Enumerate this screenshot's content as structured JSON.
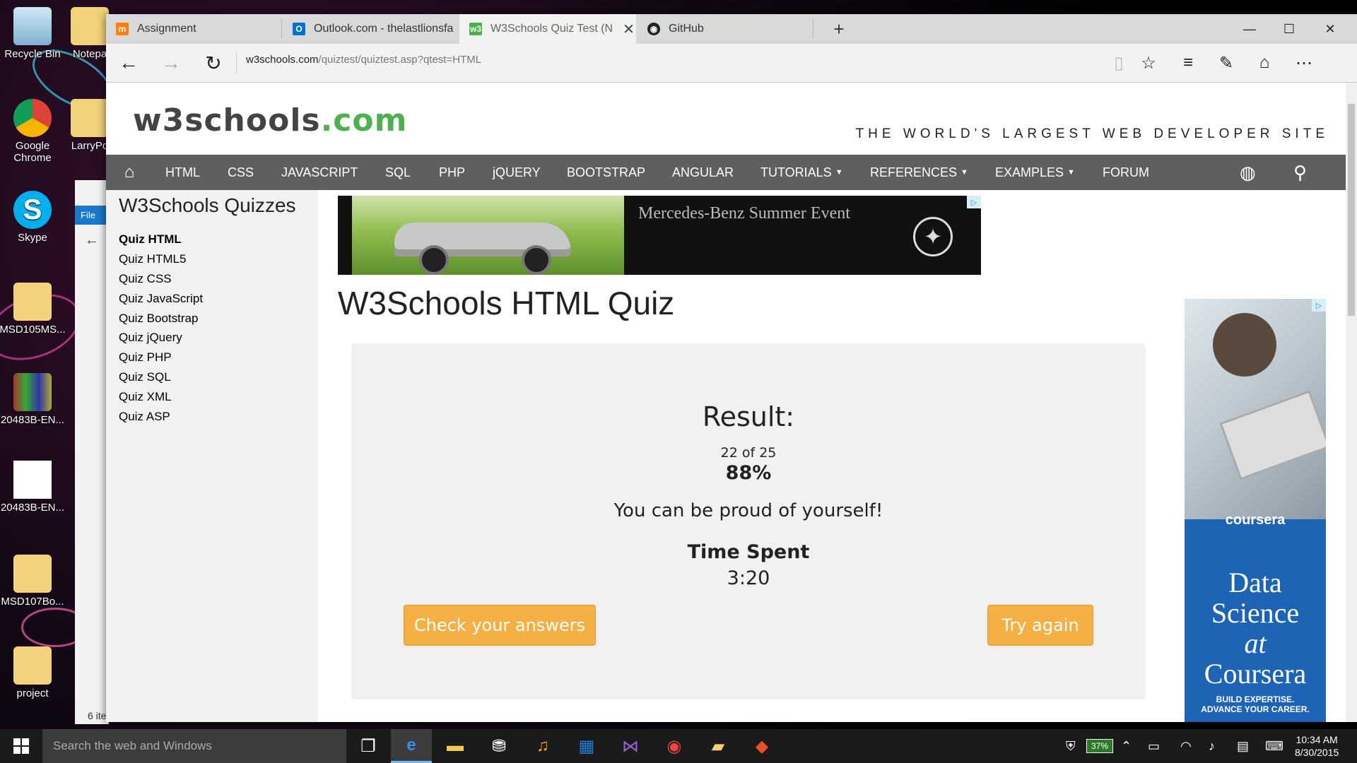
{
  "desktop": {
    "icons": [
      {
        "label": "Recycle Bin"
      },
      {
        "label": "Notepa"
      },
      {
        "label": "Google Chrome"
      },
      {
        "label": "LarryPo"
      },
      {
        "label": "Skype"
      },
      {
        "label": "MSD105MS..."
      },
      {
        "label": "20483B-EN..."
      },
      {
        "label": "20483B-EN..."
      },
      {
        "label": "MSD107Bo..."
      },
      {
        "label": "project"
      }
    ],
    "explorer": {
      "file_label": "File",
      "status": "6 ite"
    }
  },
  "browser": {
    "tabs": [
      {
        "label": "Assignment",
        "icon": "moodle-icon"
      },
      {
        "label": "Outlook.com - thelastlionsfa",
        "icon": "outlook-icon"
      },
      {
        "label": "W3Schools Quiz Test (N",
        "icon": "w3schools-icon"
      },
      {
        "label": "GitHub",
        "icon": "github-icon"
      }
    ],
    "url_host": "w3schools.com",
    "url_path": "/quiztest/quiztest.asp?qtest=HTML"
  },
  "page": {
    "logo_main": "w3schools",
    "logo_suffix": ".com",
    "tagline": "THE WORLD'S LARGEST WEB DEVELOPER SITE",
    "nav": {
      "html": "HTML",
      "css": "CSS",
      "javascript": "JAVASCRIPT",
      "sql": "SQL",
      "php": "PHP",
      "jquery": "jQUERY",
      "bootstrap": "BOOTSTRAP",
      "angular": "ANGULAR",
      "tutorials": "TUTORIALS",
      "references": "REFERENCES",
      "examples": "EXAMPLES",
      "forum": "FORUM"
    },
    "sidebar": {
      "title": "W3Schools Quizzes",
      "items": [
        {
          "label": "Quiz HTML"
        },
        {
          "label": "Quiz HTML5"
        },
        {
          "label": "Quiz CSS"
        },
        {
          "label": "Quiz JavaScript"
        },
        {
          "label": "Quiz Bootstrap"
        },
        {
          "label": "Quiz jQuery"
        },
        {
          "label": "Quiz PHP"
        },
        {
          "label": "Quiz SQL"
        },
        {
          "label": "Quiz XML"
        },
        {
          "label": "Quiz ASP"
        }
      ]
    },
    "banner_ad": {
      "text": "Mercedes-Benz Summer Event"
    },
    "quiz_title": "W3Schools HTML Quiz",
    "result": {
      "label": "Result:",
      "score": "22 of 25",
      "percent": "88%",
      "message": "You can be proud of yourself!",
      "time_label": "Time Spent",
      "time_value": "3:20",
      "check_button": "Check your answers",
      "retry_button": "Try again"
    },
    "side_ad": {
      "brand": "coursera",
      "headline_1": "Data",
      "headline_2": "Science",
      "headline_3": "at",
      "headline_4": "Coursera",
      "sub_1": "BUILD EXPERTISE.",
      "sub_2": "ADVANCE YOUR CAREER."
    }
  },
  "taskbar": {
    "search_placeholder": "Search the web and Windows",
    "battery": "37%",
    "time": "10:34 AM",
    "date": "8/30/2015"
  },
  "colors": {
    "w3_green": "#4caf50",
    "nav_gray": "#5f5f5f",
    "button_orange": "#f4b045"
  }
}
